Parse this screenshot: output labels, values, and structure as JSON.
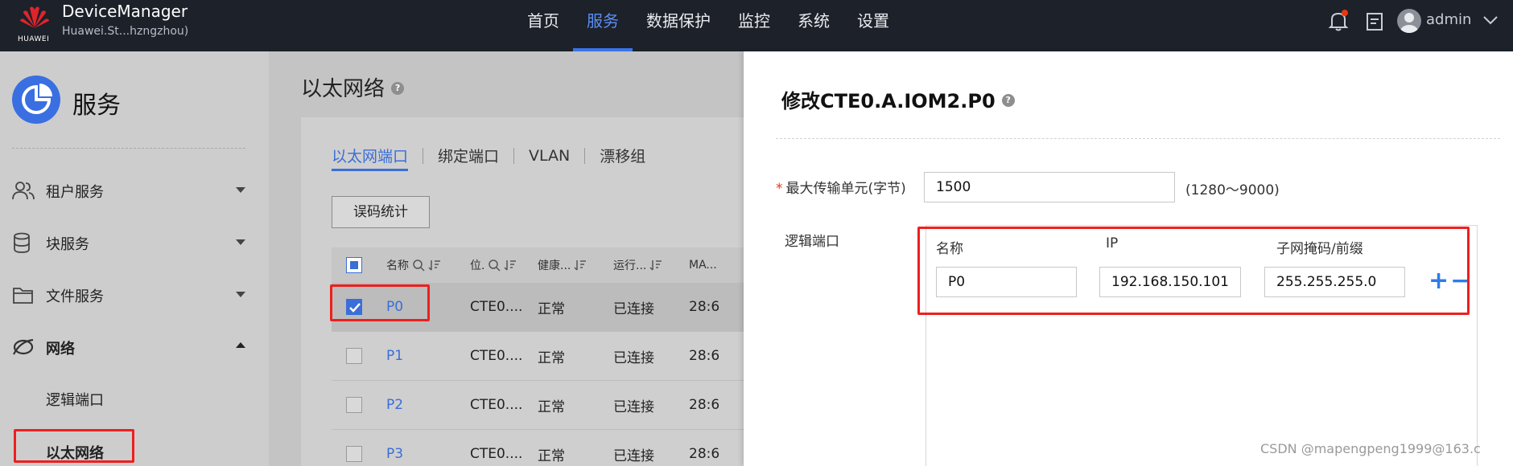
{
  "app": {
    "logo_text": "HUAWEI",
    "title": "DeviceManager",
    "subtitle": "Huawei.St...hzngzhou)"
  },
  "nav": [
    {
      "label": "首页",
      "active": false
    },
    {
      "label": "服务",
      "active": true
    },
    {
      "label": "数据保护",
      "active": false
    },
    {
      "label": "监控",
      "active": false
    },
    {
      "label": "系统",
      "active": false
    },
    {
      "label": "设置",
      "active": false
    }
  ],
  "user": {
    "name": "admin"
  },
  "sidebar": {
    "title": "服务",
    "items": [
      {
        "label": "租户服务",
        "icon": "users-icon",
        "expanded": false
      },
      {
        "label": "块服务",
        "icon": "database-icon",
        "expanded": false
      },
      {
        "label": "文件服务",
        "icon": "folder-icon",
        "expanded": false
      },
      {
        "label": "网络",
        "icon": "network-icon",
        "expanded": true
      }
    ],
    "sub_items": [
      {
        "label": "逻辑端口",
        "active": false
      },
      {
        "label": "以太网络",
        "active": true
      }
    ]
  },
  "main": {
    "title": "以太网络",
    "tabs": [
      {
        "label": "以太网端口",
        "active": true
      },
      {
        "label": "绑定端口",
        "active": false
      },
      {
        "label": "VLAN",
        "active": false
      },
      {
        "label": "漂移组",
        "active": false
      }
    ],
    "error_stats_button": "误码统计",
    "columns": [
      "名称",
      "位.",
      "健康...",
      "运行...",
      "MA..."
    ],
    "rows": [
      {
        "name": "P0",
        "location": "CTE0....",
        "health": "正常",
        "running": "已连接",
        "mac": "28:6",
        "checked": true
      },
      {
        "name": "P1",
        "location": "CTE0....",
        "health": "正常",
        "running": "已连接",
        "mac": "28:6",
        "checked": false
      },
      {
        "name": "P2",
        "location": "CTE0....",
        "health": "正常",
        "running": "已连接",
        "mac": "28:6",
        "checked": false
      },
      {
        "name": "P3",
        "location": "CTE0....",
        "health": "正常",
        "running": "已连接",
        "mac": "28:6",
        "checked": false
      }
    ]
  },
  "drawer": {
    "title": "修改CTE0.A.IOM2.P0",
    "required_mark": "*",
    "mtu_label": "最大传输单元(字节)",
    "mtu_value": "1500",
    "mtu_hint": "(1280～9000)",
    "logical_port_label": "逻辑端口",
    "lp_columns": [
      "名称",
      "IP",
      "子网掩码/前缀"
    ],
    "lp_row": {
      "name": "P0",
      "ip": "192.168.150.101",
      "mask": "255.255.255.0"
    },
    "add_symbol": "+",
    "remove_symbol": "−"
  },
  "watermark": "CSDN @mapengpeng1999@163.c",
  "colors": {
    "accent": "#3a6ed8",
    "topbar": "#1d2129",
    "highlight_red": "#ee1f1f",
    "required": "#e8380d"
  }
}
